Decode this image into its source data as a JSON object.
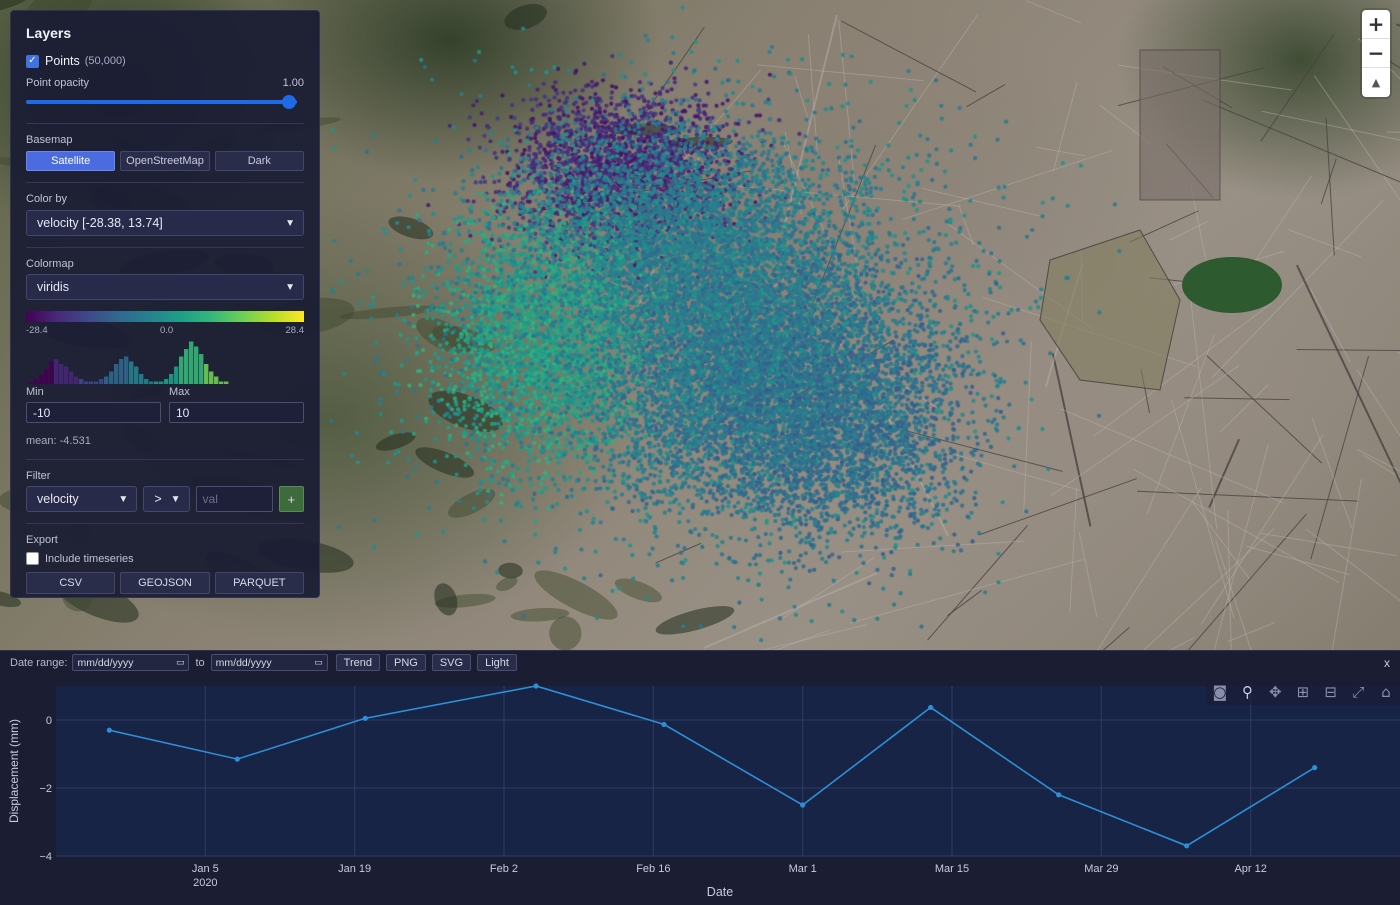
{
  "map": {
    "zoom_in": "+",
    "zoom_out": "−",
    "compass": "▲"
  },
  "panel": {
    "title": "Layers",
    "points": {
      "label": "Points",
      "count": "(50,000)",
      "checked": true
    },
    "opacity": {
      "label": "Point opacity",
      "value": "1.00",
      "level": 1.0
    },
    "basemap": {
      "label": "Basemap",
      "options": [
        "Satellite",
        "OpenStreetMap",
        "Dark"
      ],
      "selected": "Satellite"
    },
    "color_by": {
      "label": "Color by",
      "value": "velocity [-28.38, 13.74]"
    },
    "colormap": {
      "label": "Colormap",
      "value": "viridis",
      "ticks": [
        "-28.4",
        "0.0",
        "28.4"
      ]
    },
    "range": {
      "min_label": "Min",
      "max_label": "Max",
      "min_value": "-10",
      "max_value": "10",
      "mean": "mean: -4.531"
    },
    "filter": {
      "label": "Filter",
      "field": "velocity",
      "op": ">",
      "value_placeholder": "val",
      "add": "+"
    },
    "export": {
      "label": "Export",
      "include_ts": "Include timeseries",
      "buttons": [
        "CSV",
        "GEOJSON",
        "PARQUET"
      ]
    }
  },
  "toolbar": {
    "date_range_label": "Date range:",
    "date_placeholder": "mm/dd/yyyy",
    "to_label": "to",
    "buttons": [
      "Trend",
      "PNG",
      "SVG",
      "Light"
    ],
    "close": "x"
  },
  "modebar": [
    "camera-icon",
    "zoom-icon",
    "pan-icon",
    "zoom-in-icon",
    "zoom-out-icon",
    "autoscale-icon",
    "reset-axes-icon"
  ],
  "colors": {
    "accent": "#4b6be0",
    "series": "#2d8fd5",
    "plot_bg": "#182446"
  },
  "chart_data": {
    "type": "line",
    "x": [
      "2019-12-27",
      "2020-01-08",
      "2020-01-20",
      "2020-02-05",
      "2020-02-17",
      "2020-03-01",
      "2020-03-13",
      "2020-03-25",
      "2020-04-06",
      "2020-04-18"
    ],
    "series": [
      {
        "values": [
          -0.3,
          -1.15,
          0.05,
          1.0,
          -0.13,
          -2.5,
          0.37,
          -2.2,
          -3.7,
          -1.4
        ]
      }
    ],
    "xlabel": "Date",
    "ylabel": "Displacement (mm)",
    "x_ticks": [
      {
        "date": "2020-01-05",
        "label": "Jan 5",
        "sub": "2020"
      },
      {
        "date": "2020-01-19",
        "label": "Jan 19"
      },
      {
        "date": "2020-02-02",
        "label": "Feb 2"
      },
      {
        "date": "2020-02-16",
        "label": "Feb 16"
      },
      {
        "date": "2020-03-01",
        "label": "Mar 1"
      },
      {
        "date": "2020-03-15",
        "label": "Mar 15"
      },
      {
        "date": "2020-03-29",
        "label": "Mar 29"
      },
      {
        "date": "2020-04-12",
        "label": "Apr 12"
      }
    ],
    "y_ticks": [
      0,
      -2,
      -4
    ],
    "xlim": [
      "2019-12-22",
      "2020-04-26"
    ],
    "ylim": [
      -4,
      1.0
    ],
    "grid": true
  }
}
